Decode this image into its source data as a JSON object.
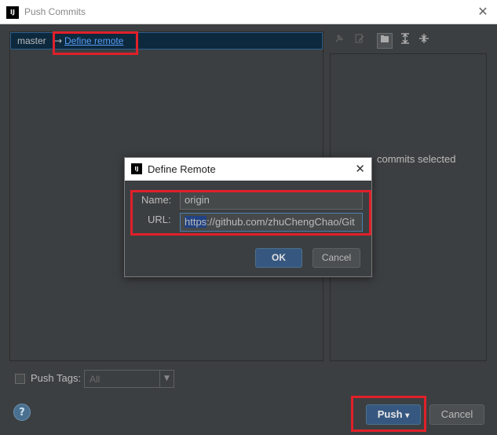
{
  "window": {
    "title": "Push Commits",
    "close_glyph": "✕",
    "logo_text": "IJ"
  },
  "branches": {
    "local_branch": "master",
    "arrow": "→",
    "define_remote_link": "Define remote"
  },
  "toolbar": {
    "icons": [
      "pin-icon",
      "edit-source-icon",
      "group-by-directory-icon",
      "expand-all-icon",
      "collapse-all-icon"
    ],
    "active_icon": "group-by-directory-icon"
  },
  "details": {
    "empty_text": "commits selected"
  },
  "push_tags": {
    "label": "Push Tags:",
    "checked": false,
    "combo_value": "All"
  },
  "buttons": {
    "push_label": "Push",
    "push_dropdown_glyph": "▾",
    "cancel_label": "Cancel",
    "help_glyph": "?"
  },
  "dialog": {
    "title": "Define Remote",
    "logo_text": "IJ",
    "close_glyph": "✕",
    "name_label": "Name:",
    "name_value": "origin",
    "url_label": "URL:",
    "url_selected_part": "https",
    "url_rest": "://github.com/zhuChengChao/Git",
    "ok_label": "OK",
    "cancel_label": "Cancel"
  },
  "colors": {
    "background": "#3c3f41",
    "accent_blue": "#365880",
    "link_blue": "#589df6",
    "highlight_red": "#e0202a"
  }
}
